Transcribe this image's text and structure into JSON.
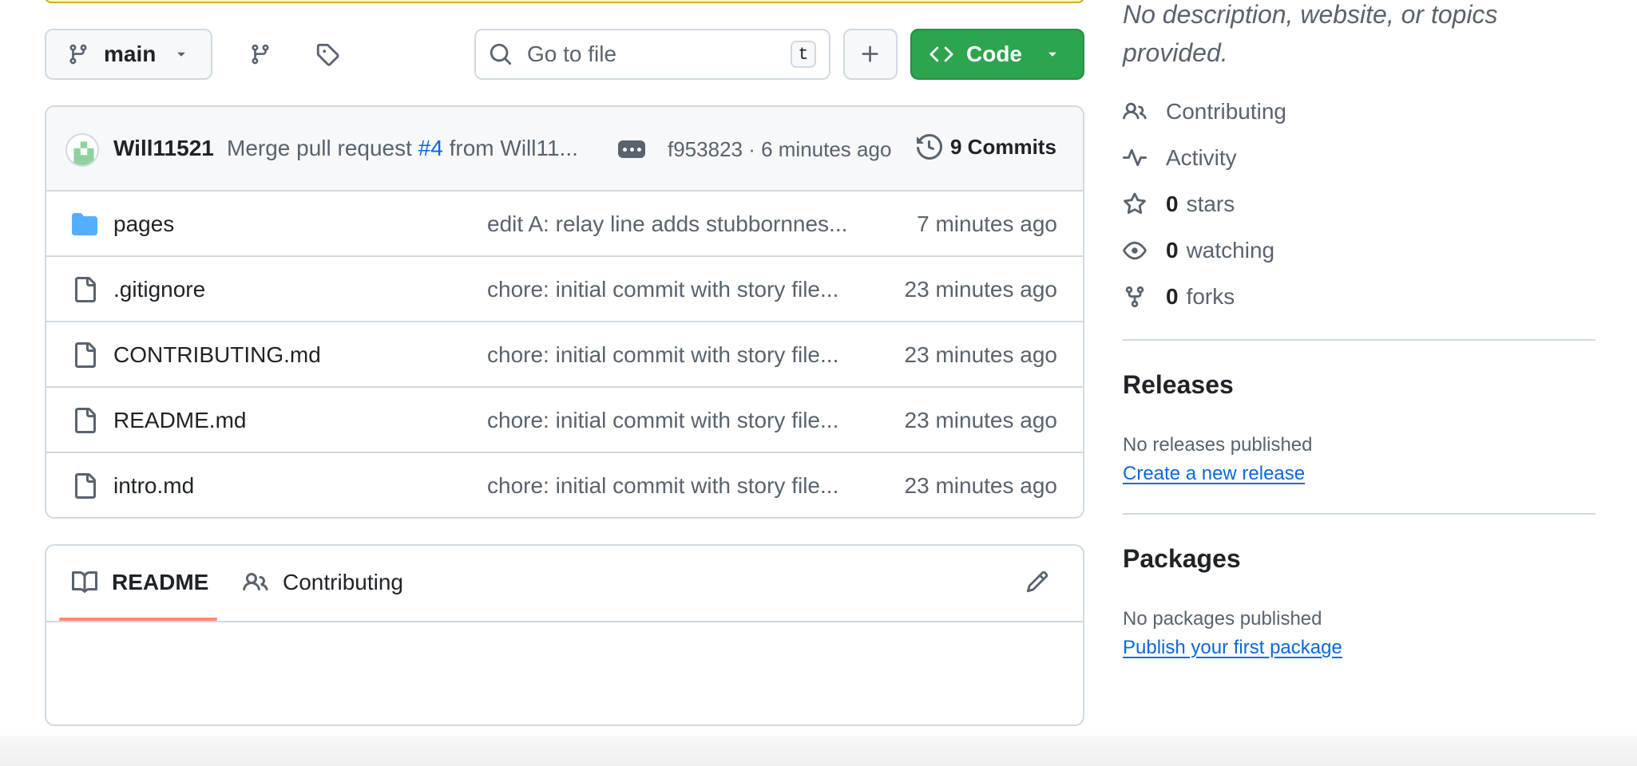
{
  "toolbar": {
    "branch": "main",
    "search_placeholder": "Go to file",
    "search_shortcut": "t",
    "code_label": "Code"
  },
  "latest_commit": {
    "author": "Will11521",
    "message_prefix": "Merge pull request",
    "pr_ref": "#4",
    "message_suffix": "from Will11...",
    "sha_time": "f953823 · 6 minutes ago",
    "commits_label": "9 Commits"
  },
  "files": [
    {
      "type": "folder",
      "name": "pages",
      "message": "edit A: relay line adds stubbornnes...",
      "time": "7 minutes ago"
    },
    {
      "type": "file",
      "name": ".gitignore",
      "message": "chore: initial commit with story file...",
      "time": "23 minutes ago"
    },
    {
      "type": "file",
      "name": "CONTRIBUTING.md",
      "message": "chore: initial commit with story file...",
      "time": "23 minutes ago"
    },
    {
      "type": "file",
      "name": "README.md",
      "message": "chore: initial commit with story file...",
      "time": "23 minutes ago"
    },
    {
      "type": "file",
      "name": "intro.md",
      "message": "chore: initial commit with story file...",
      "time": "23 minutes ago"
    }
  ],
  "readme": {
    "tabs": [
      "README",
      "Contributing"
    ]
  },
  "sidebar": {
    "about_description": "No description, website, or topics provided.",
    "contributing": "Contributing",
    "activity": "Activity",
    "stars_count": "0",
    "stars_label": "stars",
    "watching_count": "0",
    "watching_label": "watching",
    "forks_count": "0",
    "forks_label": "forks",
    "releases_heading": "Releases",
    "releases_note": "No releases published",
    "releases_link": "Create a new release",
    "packages_heading": "Packages",
    "packages_note": "No packages published",
    "packages_link": "Publish your first package"
  },
  "colors": {
    "accent": "#0969da",
    "success": "#2da44e",
    "folder": "#54aeff",
    "tab_underline": "#fd8c73",
    "warning_border": "#d4a72c"
  }
}
